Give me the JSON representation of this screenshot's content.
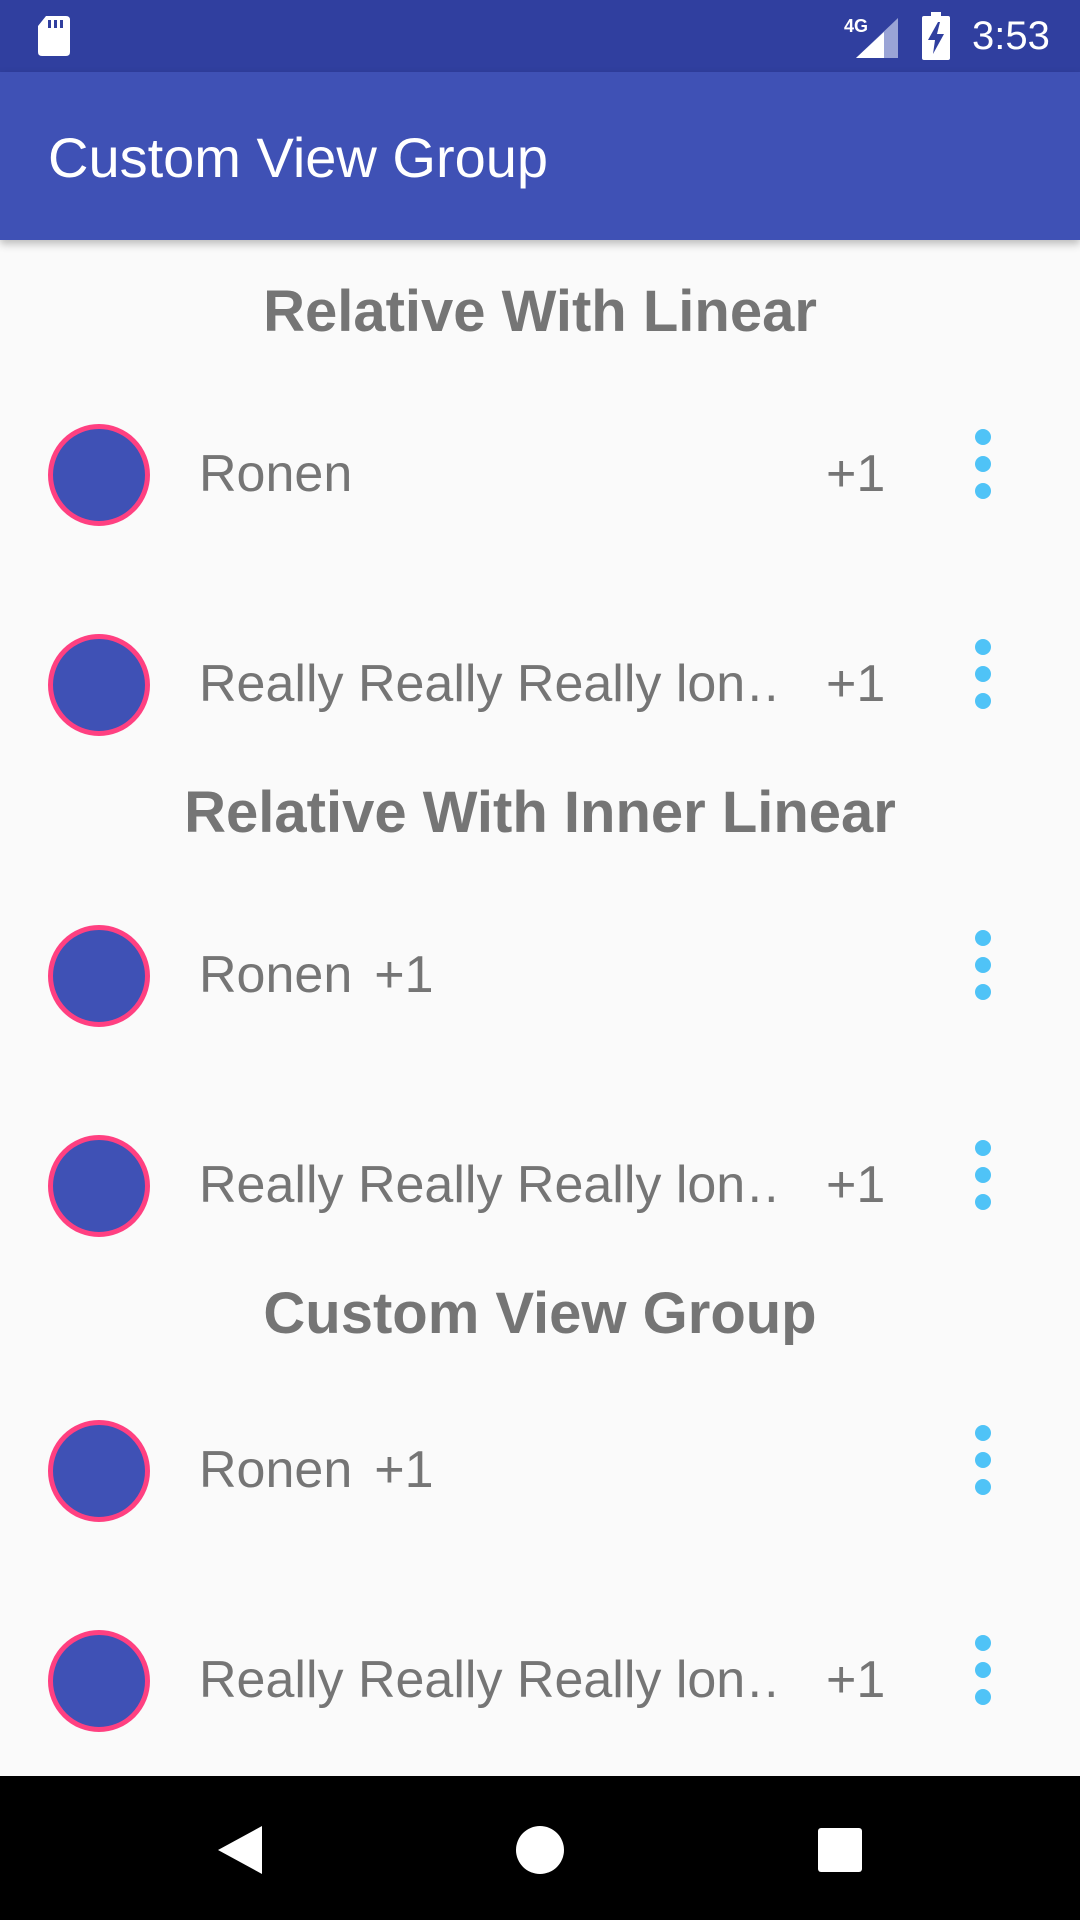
{
  "status_bar": {
    "network_label": "4G",
    "time": "3:53",
    "icons": [
      "sd-card-icon",
      "signal-icon",
      "battery-charging-icon"
    ]
  },
  "app_bar": {
    "title": "Custom View Group"
  },
  "colors": {
    "status_bar": "#303f9f",
    "primary": "#3f51b5",
    "accent": "#ff4081",
    "more_icon": "#4fc3f7",
    "text_secondary": "#757575",
    "background": "#fafafa"
  },
  "sections": [
    {
      "header": "Relative With Linear",
      "rows": [
        {
          "name": "Ronen",
          "count": "+1",
          "count_inline": false
        },
        {
          "name": "Really Really Really lon…",
          "count": "+1",
          "count_inline": false
        }
      ]
    },
    {
      "header": "Relative With Inner Linear",
      "rows": [
        {
          "name": "Ronen",
          "count": "+1",
          "count_inline": true
        },
        {
          "name": "Really Really Really lon…",
          "count": "+1",
          "count_inline": false
        }
      ]
    },
    {
      "header": "Custom View Group",
      "rows": [
        {
          "name": "Ronen",
          "count": "+1",
          "count_inline": true
        },
        {
          "name": "Really Really Really lon…",
          "count": "+1",
          "count_inline": false
        }
      ]
    }
  ],
  "nav_bar": {
    "buttons": [
      "back-icon",
      "home-icon",
      "recents-icon"
    ]
  }
}
